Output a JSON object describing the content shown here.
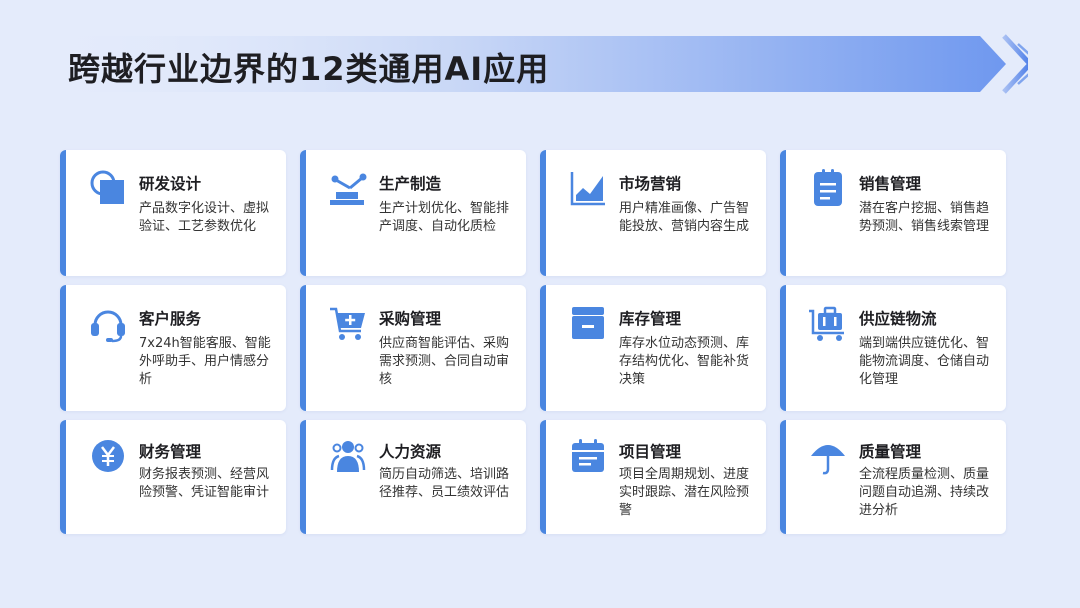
{
  "title": "跨越行业边界的12类通用AI应用",
  "colors": {
    "accent": "#4a86e0",
    "background": "#e4ebfb",
    "card": "#ffffff"
  },
  "cards": [
    {
      "title": "研发设计",
      "desc": "产品数字化设计、虚拟验证、工艺参数优化",
      "icon": "design-shapes-icon"
    },
    {
      "title": "生产制造",
      "desc": "生产计划优化、智能排产调度、自动化质检",
      "icon": "robot-arm-icon"
    },
    {
      "title": "市场营销",
      "desc": "用户精准画像、广告智能投放、营销内容生成",
      "icon": "area-chart-icon"
    },
    {
      "title": "销售管理",
      "desc": "潜在客户挖掘、销售趋势预测、销售线索管理",
      "icon": "clipboard-icon"
    },
    {
      "title": "客户服务",
      "desc": "7x24h智能客服、智能外呼助手、用户情感分析",
      "icon": "headset-icon"
    },
    {
      "title": "采购管理",
      "desc": "供应商智能评估、采购需求预测、合同自动审核",
      "icon": "shopping-cart-icon"
    },
    {
      "title": "库存管理",
      "desc": "库存水位动态预测、库存结构优化、智能补货决策",
      "icon": "inventory-box-icon"
    },
    {
      "title": "供应链物流",
      "desc": "端到端供应链优化、智能物流调度、仓储自动化管理",
      "icon": "logistics-cart-icon"
    },
    {
      "title": "财务管理",
      "desc": "财务报表预测、经营风险预警、凭证智能审计",
      "icon": "yuan-coin-icon"
    },
    {
      "title": "人力资源",
      "desc": "简历自动筛选、培训路径推荐、员工绩效评估",
      "icon": "people-icon"
    },
    {
      "title": "项目管理",
      "desc": "项目全周期规划、进度实时跟踪、潜在风险预警",
      "icon": "calendar-icon"
    },
    {
      "title": "质量管理",
      "desc": "全流程质量检测、质量问题自动追溯、持续改进分析",
      "icon": "umbrella-icon"
    }
  ]
}
